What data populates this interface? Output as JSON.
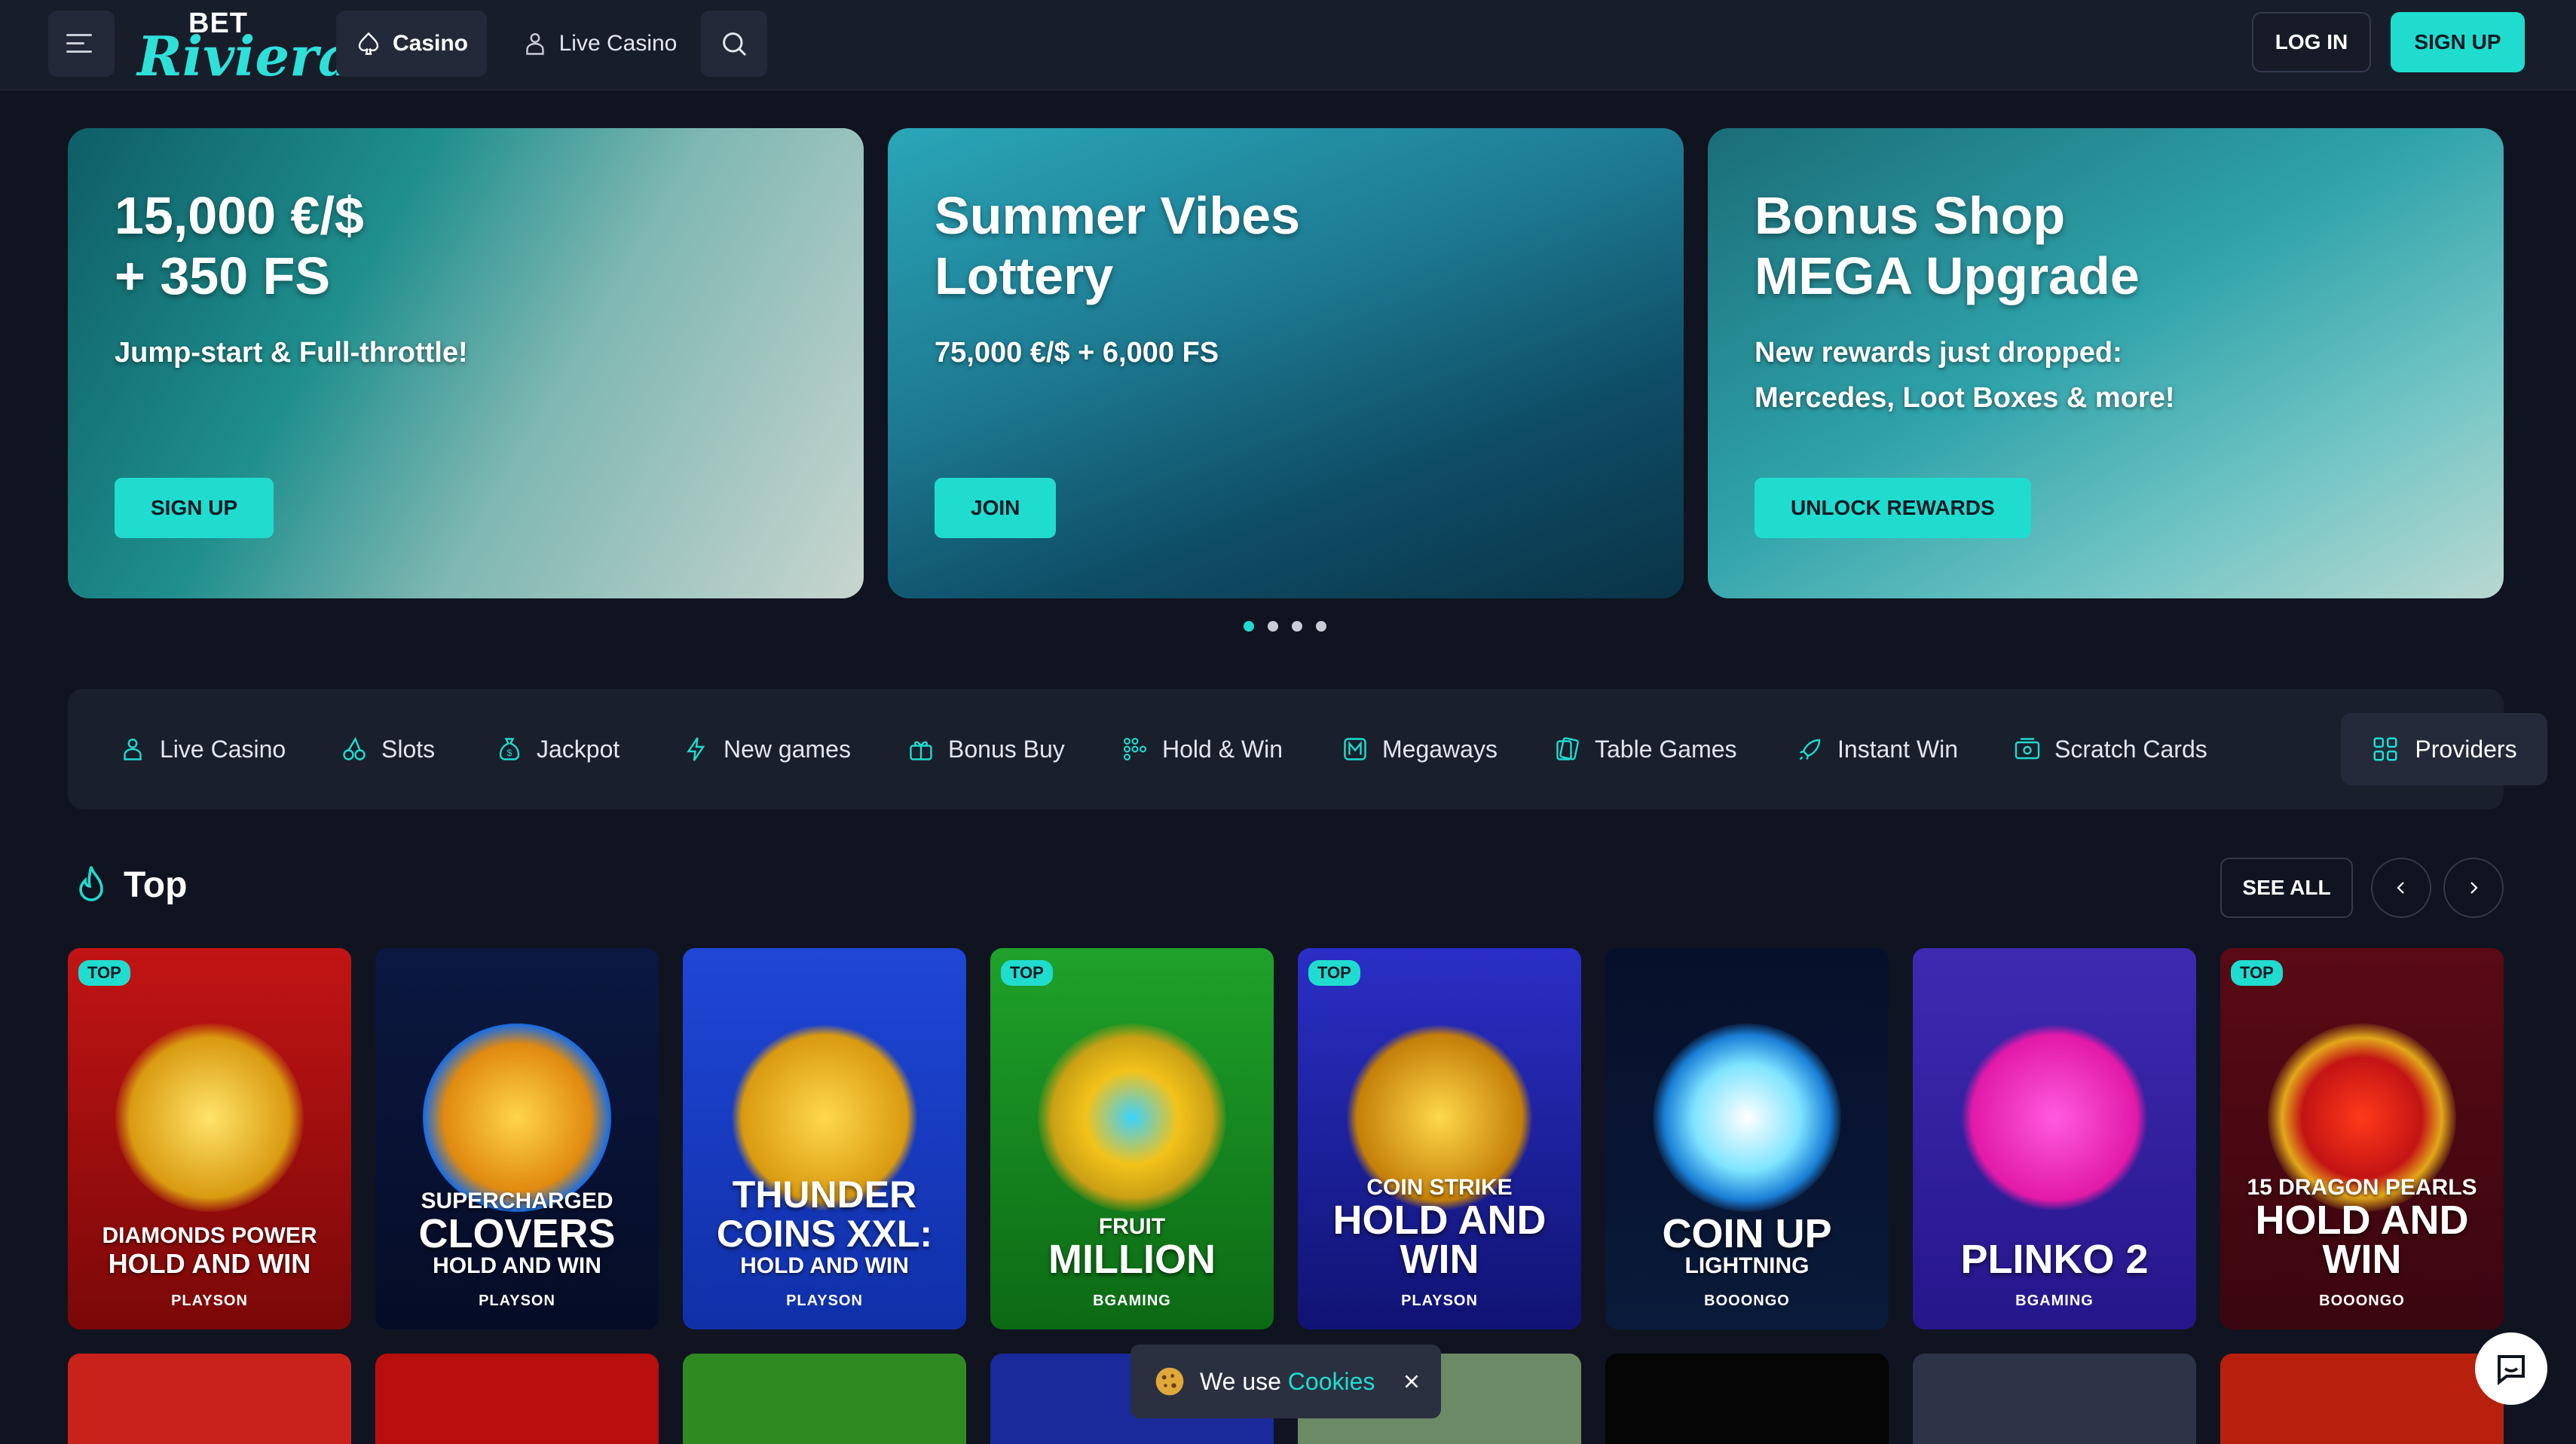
{
  "header": {
    "logo_top": "BET",
    "logo_bottom": "Riviera",
    "nav_casino": "Casino",
    "nav_live": "Live Casino",
    "login": "LOG IN",
    "signup": "SIGN UP"
  },
  "banners": [
    {
      "title_1": "15,000 €/$",
      "title_2": "+ 350 FS",
      "text_1": "Jump-start & Full-throttle!",
      "text_2": "",
      "cta": "SIGN UP"
    },
    {
      "title_1": "Summer Vibes",
      "title_2": "Lottery",
      "text_1": "75,000 €/$ + 6,000 FS",
      "text_2": "",
      "cta": "JOIN"
    },
    {
      "title_1": "Bonus Shop",
      "title_2": "MEGA Upgrade",
      "text_1": "New rewards just dropped:",
      "text_2": "Mercedes, Loot Boxes & more!",
      "cta": "UNLOCK REWARDS"
    }
  ],
  "categories": [
    "Live Casino",
    "Slots",
    "Jackpot",
    "New games",
    "Bonus Buy",
    "Hold & Win",
    "Megaways",
    "Table Games",
    "Instant Win",
    "Scratch Cards"
  ],
  "providers_label": "Providers",
  "section": {
    "title": "Top",
    "see_all": "SEE ALL"
  },
  "badge": "TOP",
  "games": [
    {
      "top": true,
      "sm": "DIAMONDS POWER",
      "lg": "HOLD AND WIN",
      "lg_small": true,
      "provider": "PLAYSON"
    },
    {
      "top": false,
      "sm": "SUPERCHARGED",
      "lg": "CLOVERS",
      "sub": "HOLD AND WIN",
      "provider": "PLAYSON"
    },
    {
      "top": false,
      "sm": "",
      "lg": "THUNDER COINS XXL:",
      "sub": "HOLD AND WIN",
      "provider": "PLAYSON"
    },
    {
      "top": true,
      "sm": "FRUIT",
      "lg": "MILLION",
      "provider": "BGAMING"
    },
    {
      "top": true,
      "sm": "COIN STRIKE",
      "lg": "HOLD AND WIN",
      "provider": "PLAYSON"
    },
    {
      "top": false,
      "sm": "",
      "lg": "COIN UP",
      "sub": "LIGHTNING",
      "provider": "BOOONGO"
    },
    {
      "top": false,
      "sm": "",
      "lg": "PLINKO 2",
      "provider": "BGAMING"
    },
    {
      "top": true,
      "sm": "15 DRAGON PEARLS",
      "lg": "HOLD AND WIN",
      "provider": "BOOONGO"
    }
  ],
  "cookie": {
    "text": "We use",
    "link": "Cookies"
  }
}
